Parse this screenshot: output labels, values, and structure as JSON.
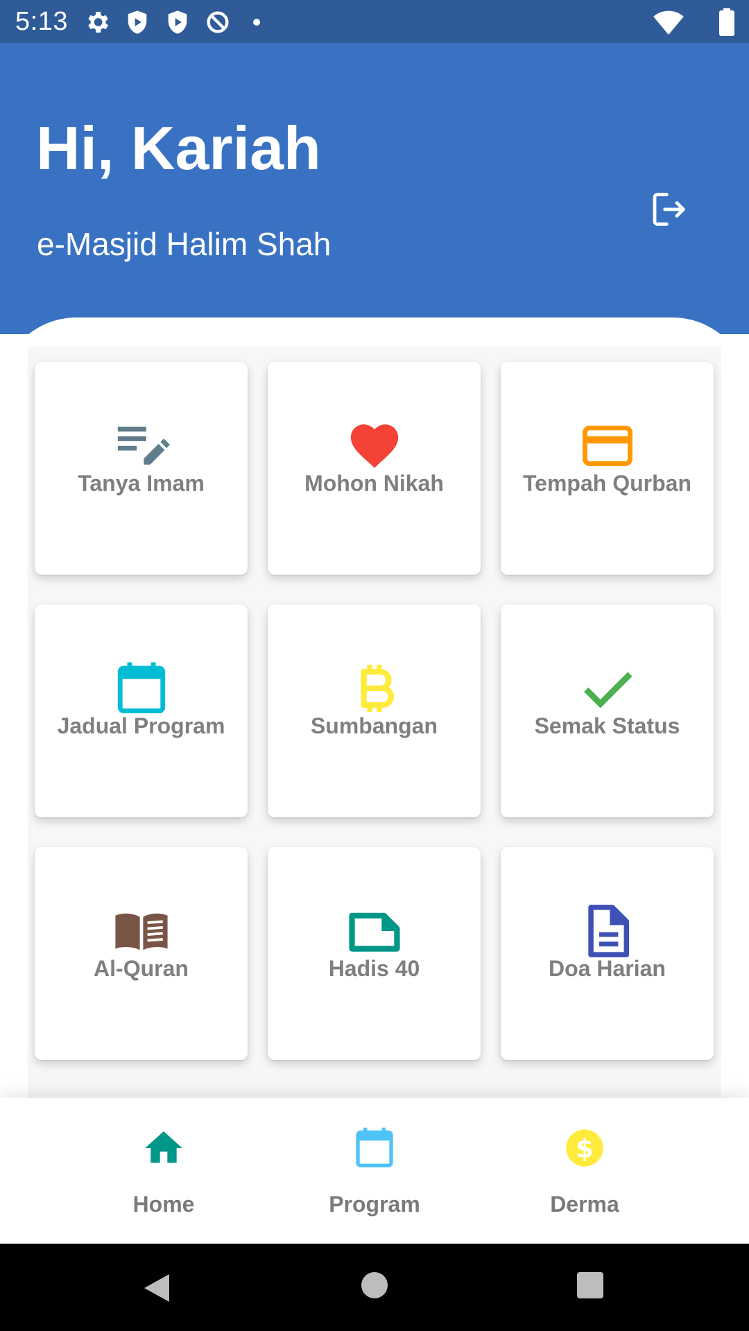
{
  "status_bar": {
    "time": "5:13",
    "icons": [
      "gear-icon",
      "shield-play-icon",
      "shield-play-icon",
      "data-saver-icon",
      "dot",
      "wifi-icon",
      "battery-icon"
    ]
  },
  "header": {
    "greeting": "Hi, Kariah",
    "mosque_name": "e-Masjid Halim Shah",
    "logout_icon": "logout-icon"
  },
  "menu": [
    {
      "label": "Tanya Imam",
      "icon": "edit-notes-icon",
      "color": "#607d8b"
    },
    {
      "label": "Mohon Nikah",
      "icon": "heart-icon",
      "color": "#f44336"
    },
    {
      "label": "Tempah Qurban",
      "icon": "credit-card-icon",
      "color": "#ff9800"
    },
    {
      "label": "Jadual Program",
      "icon": "calendar-icon",
      "color": "#00bcd4"
    },
    {
      "label": "Sumbangan",
      "icon": "bitcoin-icon",
      "color": "#ffeb3b"
    },
    {
      "label": "Semak Status",
      "icon": "check-icon",
      "color": "#4caf50"
    },
    {
      "label": "Al-Quran",
      "icon": "book-icon",
      "color": "#795548"
    },
    {
      "label": "Hadis 40",
      "icon": "note-icon",
      "color": "#009688"
    },
    {
      "label": "Doa Harian",
      "icon": "document-icon",
      "color": "#3f51b5"
    }
  ],
  "bottom_nav": [
    {
      "label": "Home",
      "icon": "home-icon",
      "color": "#009688"
    },
    {
      "label": "Program",
      "icon": "calendar-icon",
      "color": "#4fc3f7"
    },
    {
      "label": "Derma",
      "icon": "dollar-coin-icon",
      "color": "#ffeb3b"
    }
  ],
  "colors": {
    "status_bar": "#2f5b98",
    "header": "#3972c3",
    "label_gray": "#7f7f7f"
  }
}
